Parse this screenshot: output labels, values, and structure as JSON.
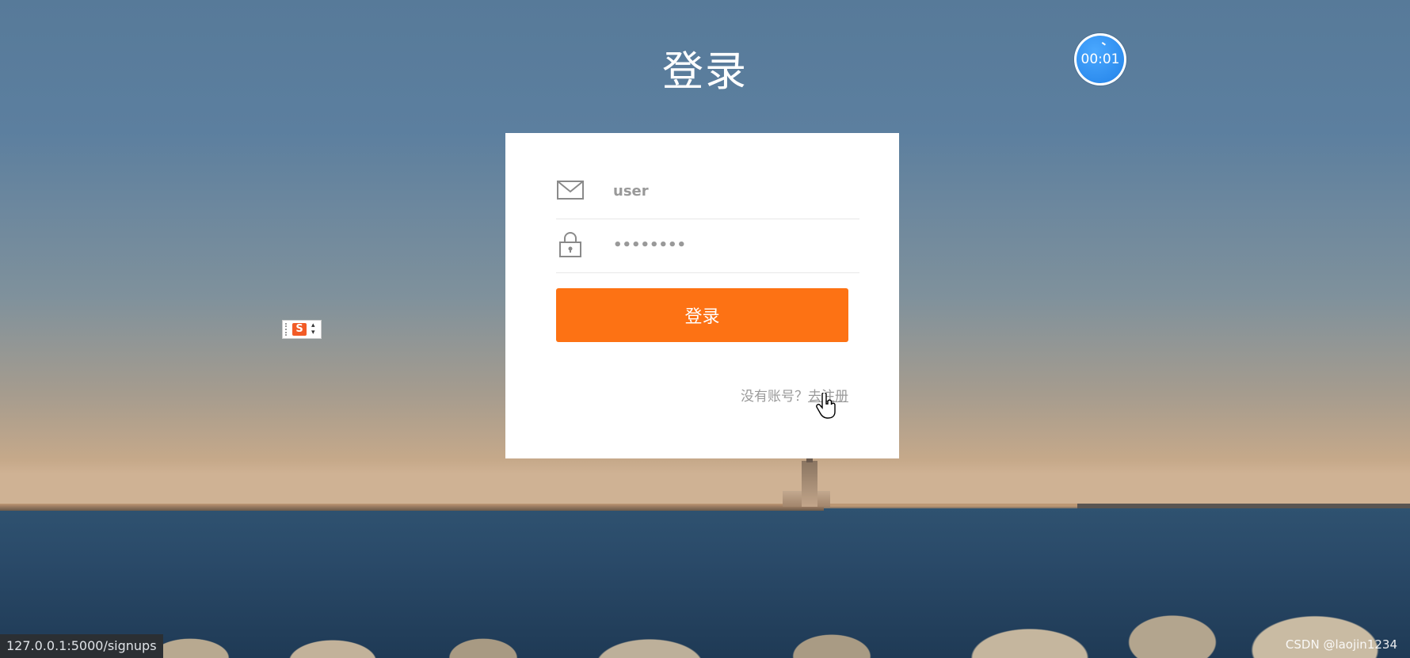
{
  "page": {
    "title": "登录"
  },
  "timer": {
    "value": "00:01"
  },
  "form": {
    "username": {
      "value": "user",
      "icon": "mail-icon"
    },
    "password": {
      "value": "••••••••",
      "icon": "lock-icon"
    },
    "submit_label": "登录",
    "register_prompt": "没有账号？",
    "register_link": "去注册"
  },
  "status_bar": {
    "url": "127.0.0.1:5000/signups"
  },
  "watermark": "CSDN @laojin1234",
  "ime": {
    "logo": "S"
  },
  "colors": {
    "accent": "#fd7214",
    "timer": "#1f7fe6"
  }
}
